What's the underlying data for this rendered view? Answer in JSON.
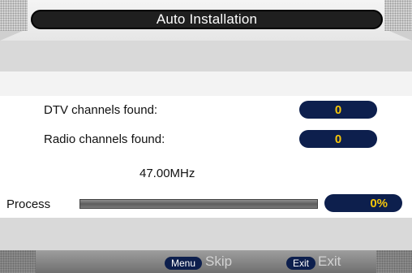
{
  "title": "Auto Installation",
  "rows": {
    "dtv_label": "DTV channels found:",
    "dtv_value": "0",
    "radio_label": "Radio channels found:",
    "radio_value": "0"
  },
  "frequency": "47.00MHz",
  "process": {
    "label": "Process",
    "percent_text": "0%",
    "fraction": 0
  },
  "footer": {
    "menu_key": "Menu",
    "menu_action": "Skip",
    "exit_key": "Exit",
    "exit_action": "Exit"
  },
  "colors": {
    "pill": "#0d1f4d",
    "value_text": "#f6c60a",
    "title_bar": "#1f1f1f"
  }
}
